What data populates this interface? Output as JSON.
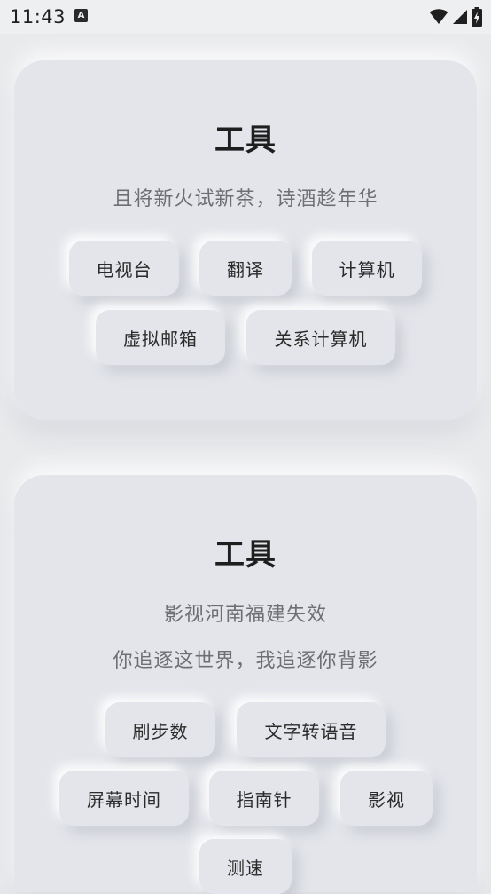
{
  "status_bar": {
    "time": "11:43",
    "notification_icon_letter": "A",
    "icons": [
      "wifi-icon",
      "cell-signal-icon",
      "battery-charging-icon"
    ]
  },
  "cards": [
    {
      "title": "工具",
      "lines": [
        "且将新火试新茶，诗酒趁年华"
      ],
      "buttons": [
        "电视台",
        "翻译",
        "计算机",
        "虚拟邮箱",
        "关系计算机"
      ]
    },
    {
      "title": "工具",
      "lines": [
        "影视河南福建失效",
        "你追逐这世界，我追逐你背影"
      ],
      "buttons": [
        "刷步数",
        "文字转语音",
        "屏幕时间",
        "指南针",
        "影视",
        "测速"
      ]
    }
  ],
  "colors": {
    "background": "#e9eaec",
    "card": "#e3e5ea",
    "title": "#1e1e1e",
    "subtitle": "#6f6f73"
  }
}
